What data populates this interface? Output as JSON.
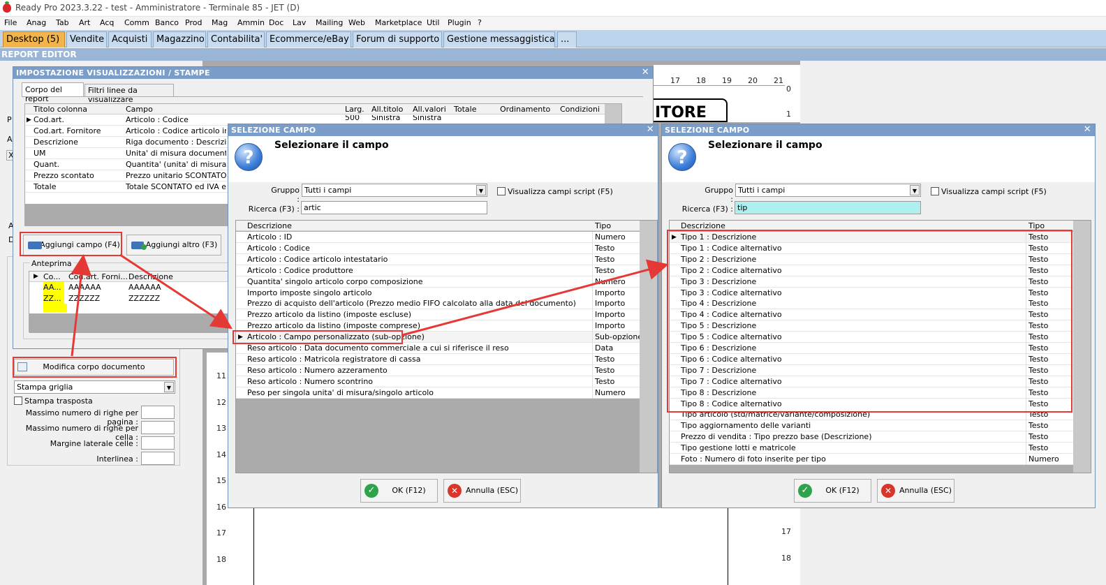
{
  "titlebar": {
    "title": "Ready Pro 2023.3.22 - test - Amministratore - Terminale 85 - JET (D)"
  },
  "menu": [
    "File",
    "Anag",
    "Tab",
    "Art",
    "Acq",
    "Comm",
    "Banco",
    "Prod",
    "Mag",
    "Ammin",
    "Doc",
    "Lav",
    "Mailing",
    "Web",
    "Marketplace",
    "Util",
    "Plugin",
    "?"
  ],
  "tabs": [
    "Desktop (5)",
    "Vendite",
    "Acquisti",
    "Magazzino",
    "Contabilita'",
    "Ecommerce/eBay",
    "Forum di supporto",
    "Gestione messaggistica",
    "..."
  ],
  "report_editor": "REPORT EDITOR",
  "ruler": {
    "top": [
      "17",
      "18",
      "19",
      "20",
      "21"
    ],
    "right": [
      "0",
      "1"
    ],
    "left": [
      "11",
      "12",
      "13",
      "14",
      "15",
      "16",
      "17",
      "18"
    ],
    "right_bottom": [
      "17",
      "18"
    ],
    "preview_text": "ITORE"
  },
  "imp": {
    "title": "IMPOSTAZIONE VISUALIZZAZIONI / STAMPE",
    "tabs": [
      "Corpo del report",
      "Filtri linee da visualizzare"
    ],
    "headers": [
      "Titolo colonna",
      "Campo",
      "Larg.",
      "All.titolo",
      "All.valori",
      "Totale",
      "Ordinamento",
      "Condizioni"
    ],
    "first_row": {
      "larg": "500",
      "titolo": "Sinistra",
      "valori": "Sinistra"
    },
    "rows": [
      {
        "titolo": "Cod.art.",
        "campo": "Articolo : Codice"
      },
      {
        "titolo": "Cod.art. Fornitore",
        "campo": "Articolo : Codice articolo intest"
      },
      {
        "titolo": "Descrizione",
        "campo": "Riga documento : Descrizione"
      },
      {
        "titolo": "UM",
        "campo": "Unita' di misura documento"
      },
      {
        "titolo": "Quant.",
        "campo": "Quantita' (unita' di misura docu"
      },
      {
        "titolo": "Prezzo scontato",
        "campo": "Prezzo unitario SCONTATO ed"
      },
      {
        "titolo": "Totale",
        "campo": "Totale SCONTATO ed IVA escl"
      }
    ],
    "btn_add_field": "Aggiungi campo (F4)",
    "btn_add_other": "Aggiungi altro (F3)",
    "preview": {
      "label": "Anteprima",
      "headers": [
        "Co...",
        "Cod.art. Forni...",
        "Descrizione"
      ],
      "rows": [
        [
          "AA...",
          "AAAAAA",
          "AAAAAA"
        ],
        [
          "ZZ...",
          "ZZZZZZ",
          "ZZZZZZ"
        ]
      ]
    }
  },
  "left_panel": {
    "side_letters": [
      "P",
      "A",
      "X",
      "A",
      "D"
    ],
    "btn_modify": "Modifica corpo documento",
    "print_type": "Stampa griglia",
    "transposed": "Stampa trasposta",
    "fields": [
      "Massimo numero di righe per pagina :",
      "Massimo numero di righe per cella :",
      "Margine laterale celle :",
      "Interlinea :"
    ]
  },
  "sel1": {
    "title": "SELEZIONE CAMPO",
    "heading": "Selezionare il campo",
    "group_label": "Gruppo :",
    "group_value": "Tutti i campi",
    "script_label": "Visualizza campi script (F5)",
    "search_label": "Ricerca (F3) :",
    "search_value": "artic",
    "col_desc": "Descrizione",
    "col_type": "Tipo",
    "rows": [
      [
        "Articolo : ID",
        "Numero"
      ],
      [
        "Articolo : Codice",
        "Testo"
      ],
      [
        "Articolo : Codice articolo intestatario",
        "Testo"
      ],
      [
        "Articolo : Codice produttore",
        "Testo"
      ],
      [
        "Quantita' singolo articolo corpo composizione",
        "Numero"
      ],
      [
        "Importo imposte singolo articolo",
        "Importo"
      ],
      [
        "Prezzo di acquisto dell'articolo (Prezzo medio FIFO calcolato alla data del documento)",
        "Importo"
      ],
      [
        "Prezzo articolo da listino (imposte escluse)",
        "Importo"
      ],
      [
        "Prezzo articolo da listino (imposte comprese)",
        "Importo"
      ],
      [
        "Articolo : Campo personalizzato (sub-opzione)",
        "Sub-opzione"
      ],
      [
        "Reso articolo : Data documento commerciale a cui si riferisce il reso",
        "Data"
      ],
      [
        "Reso articolo : Matricola registratore di cassa",
        "Testo"
      ],
      [
        "Reso articolo : Numero azzeramento",
        "Testo"
      ],
      [
        "Reso articolo : Numero scontrino",
        "Testo"
      ],
      [
        "Peso per singola unita' di misura/singolo articolo",
        "Numero"
      ]
    ],
    "ok": "OK (F12)",
    "cancel": "Annulla (ESC)"
  },
  "sel2": {
    "title": "SELEZIONE CAMPO",
    "heading": "Selezionare il campo",
    "group_label": "Gruppo :",
    "group_value": "Tutti i campi",
    "script_label": "Visualizza campi script (F5)",
    "search_label": "Ricerca (F3) :",
    "search_value": "tip",
    "col_desc": "Descrizione",
    "col_type": "Tipo",
    "rows": [
      [
        "Tipo 1 : Descrizione",
        "Testo"
      ],
      [
        "Tipo 1 : Codice alternativo",
        "Testo"
      ],
      [
        "Tipo 2 : Descrizione",
        "Testo"
      ],
      [
        "Tipo 2 : Codice alternativo",
        "Testo"
      ],
      [
        "Tipo 3 : Descrizione",
        "Testo"
      ],
      [
        "Tipo 3 : Codice alternativo",
        "Testo"
      ],
      [
        "Tipo 4 : Descrizione",
        "Testo"
      ],
      [
        "Tipo 4 : Codice alternativo",
        "Testo"
      ],
      [
        "Tipo 5 : Descrizione",
        "Testo"
      ],
      [
        "Tipo 5 : Codice alternativo",
        "Testo"
      ],
      [
        "Tipo 6 : Descrizione",
        "Testo"
      ],
      [
        "Tipo 6 : Codice alternativo",
        "Testo"
      ],
      [
        "Tipo 7 : Descrizione",
        "Testo"
      ],
      [
        "Tipo 7 : Codice alternativo",
        "Testo"
      ],
      [
        "Tipo 8 : Descrizione",
        "Testo"
      ],
      [
        "Tipo 8 : Codice alternativo",
        "Testo"
      ],
      [
        "Tipo articolo (std/matrice/variante/composizione)",
        "Testo"
      ],
      [
        "Tipo aggiornamento delle varianti",
        "Testo"
      ],
      [
        "Prezzo di vendita : Tipo prezzo base (Descrizione)",
        "Testo"
      ],
      [
        "Tipo gestione lotti e matricole",
        "Testo"
      ],
      [
        "Foto : Numero di foto inserite per tipo",
        "Numero"
      ]
    ],
    "ok": "OK (F12)",
    "cancel": "Annulla (ESC)"
  },
  "colors": {
    "accent": "#f2b54b",
    "window_header": "#7a9ec9",
    "highlight": "#e53935",
    "search_active": "#aef0ef"
  }
}
